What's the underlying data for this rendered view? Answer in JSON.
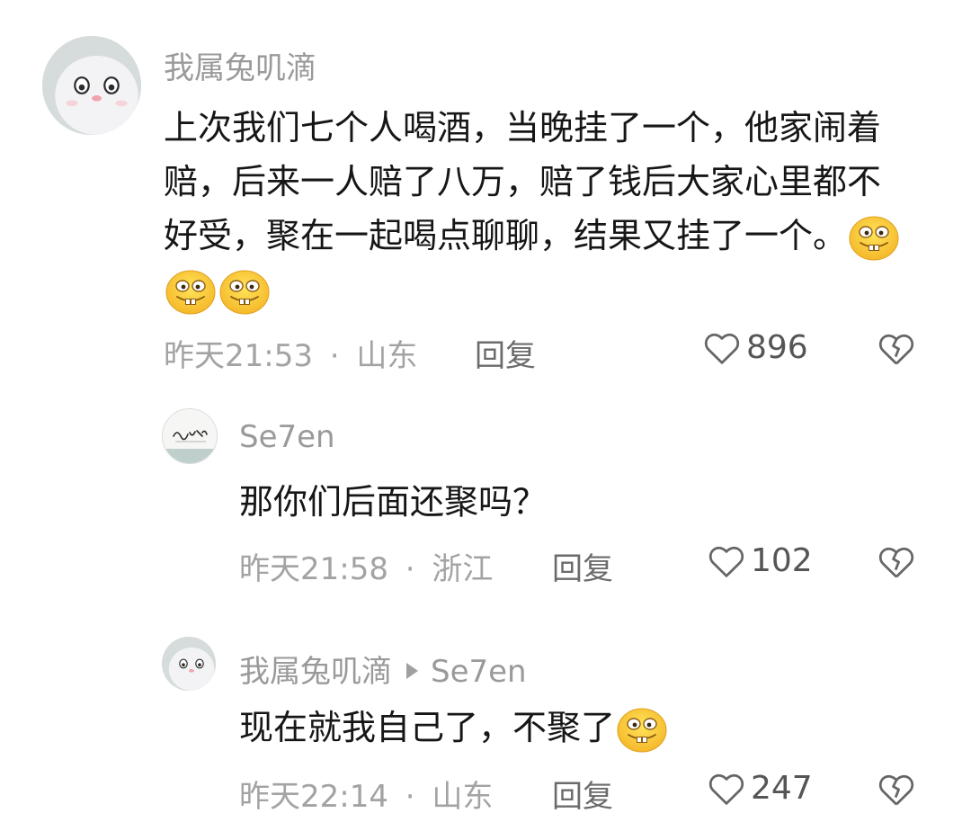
{
  "comments": [
    {
      "user": "我属兔叽滴",
      "text": "上次我们七个人喝酒，当晚挂了一个，他家闹着赔，后来一人赔了八万，赔了钱后大家心里都不好受，聚在一起喝点聊聊，结果又挂了一个。",
      "emoji_count": 3,
      "time": "昨天21:53",
      "separator": "·",
      "location": "山东",
      "reply_label": "回复",
      "likes": "896"
    },
    {
      "user": "Se7en",
      "text": "那你们后面还聚吗？",
      "time": "昨天21:58",
      "separator": "·",
      "location": "浙江",
      "reply_label": "回复",
      "likes": "102"
    },
    {
      "user": "我属兔叽滴",
      "reply_to": "Se7en",
      "text": "现在就我自己了，不聚了",
      "emoji_count": 1,
      "time": "昨天22:14",
      "separator": "·",
      "location": "山东",
      "reply_label": "回复",
      "likes": "247"
    }
  ],
  "icons": {
    "like": "heart-outline-icon",
    "dislike": "broken-heart-icon",
    "emoji": "grinning-face-emoji"
  },
  "colors": {
    "meta": "#a3a3a3",
    "username": "#9a9a9a",
    "text": "#161616"
  }
}
